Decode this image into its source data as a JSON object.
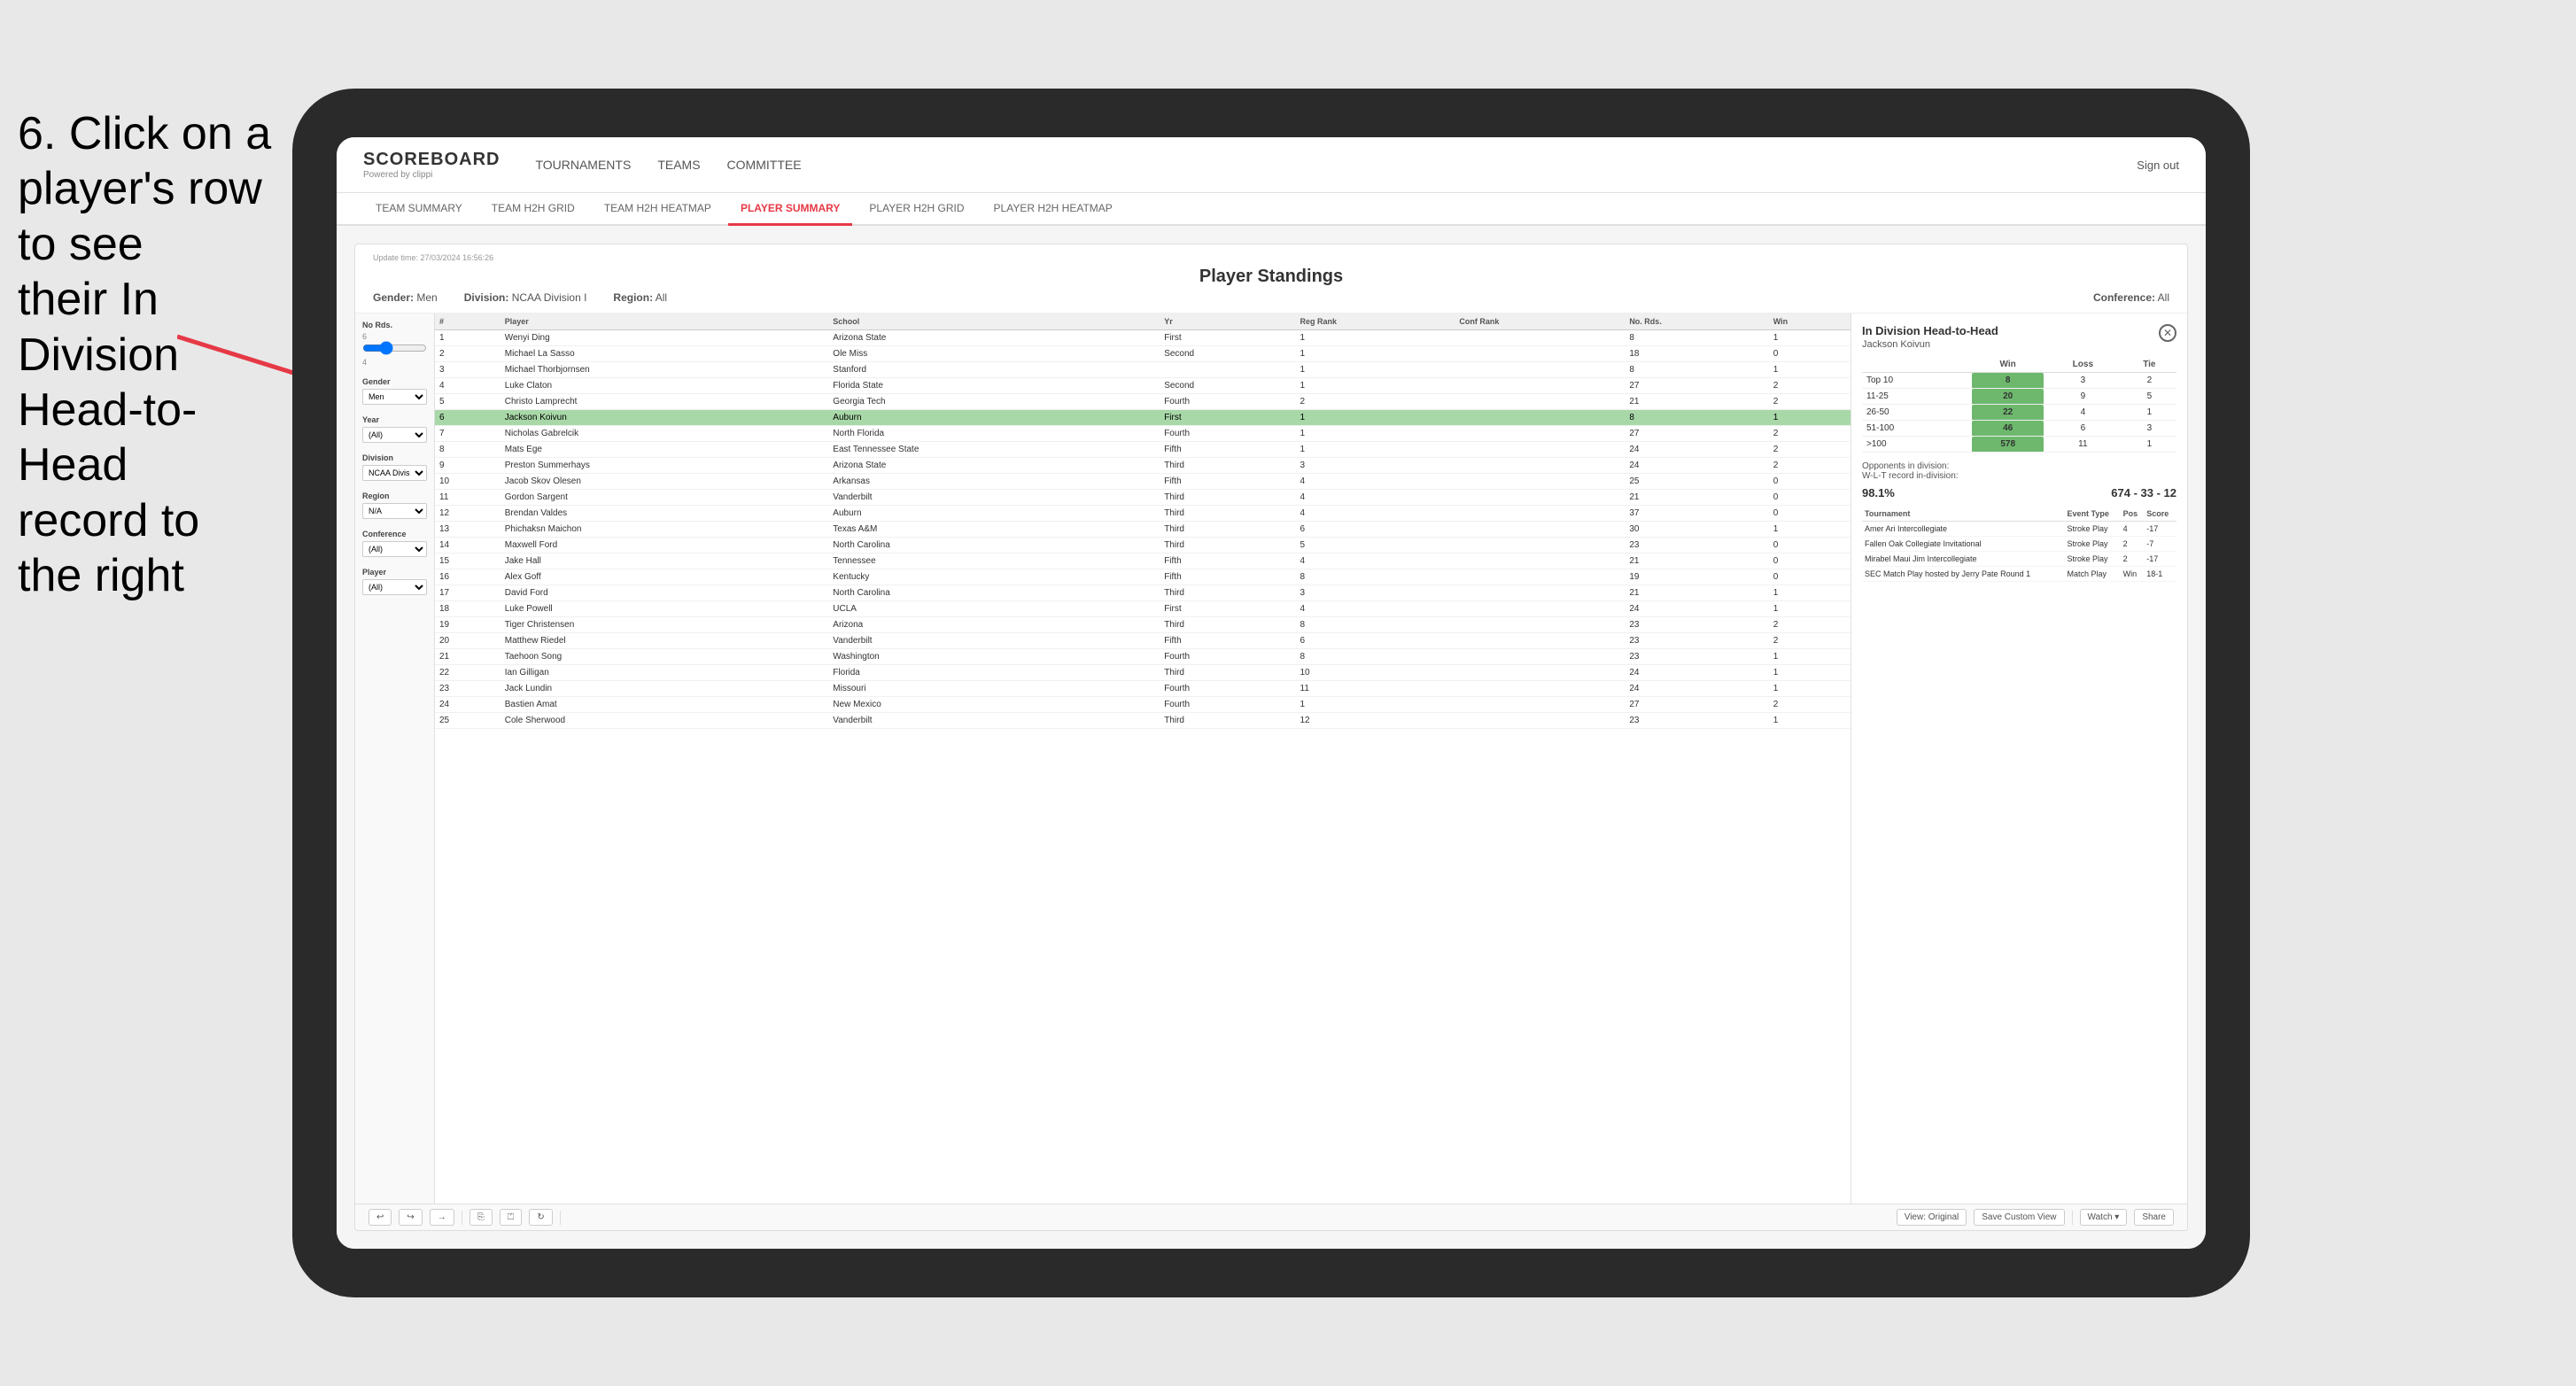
{
  "instruction": {
    "line1": "6. Click on a",
    "line2": "player's row to see",
    "line3": "their In Division",
    "line4": "Head-to-Head",
    "line5": "record to the right"
  },
  "nav": {
    "logo": "SCOREBOARD",
    "powered": "Powered by clippi",
    "items": [
      "TOURNAMENTS",
      "TEAMS",
      "COMMITTEE"
    ],
    "sign_out": "Sign out"
  },
  "sub_nav": {
    "items": [
      "TEAM SUMMARY",
      "TEAM H2H GRID",
      "TEAM H2H HEATMAP",
      "PLAYER SUMMARY",
      "PLAYER H2H GRID",
      "PLAYER H2H HEATMAP"
    ],
    "active": "PLAYER SUMMARY"
  },
  "report": {
    "update_time": "Update time:",
    "update_value": "27/03/2024 16:56:26",
    "title": "Player Standings",
    "gender_label": "Gender:",
    "gender_value": "Men",
    "division_label": "Division:",
    "division_value": "NCAA Division I",
    "region_label": "Region:",
    "region_value": "All",
    "conference_label": "Conference:",
    "conference_value": "All"
  },
  "filters": {
    "no_rds_label": "No Rds.",
    "no_rds_value": "6",
    "no_rds_min": "4",
    "gender_label": "Gender",
    "gender_value": "Men",
    "year_label": "Year",
    "year_value": "(All)",
    "division_label": "Division",
    "division_value": "NCAA Division I",
    "region_label": "Region",
    "region_value": "N/A",
    "conference_label": "Conference",
    "conference_value": "(All)",
    "player_label": "Player",
    "player_value": "(All)"
  },
  "table": {
    "headers": [
      "#",
      "Player",
      "School",
      "Yr",
      "Reg Rank",
      "Conf Rank",
      "No. Rds.",
      "Win"
    ],
    "rows": [
      {
        "num": 1,
        "player": "Wenyi Ding",
        "school": "Arizona State",
        "yr": "First",
        "reg": 1,
        "conf": "",
        "rds": 8,
        "win": 1,
        "highlighted": false
      },
      {
        "num": 2,
        "player": "Michael La Sasso",
        "school": "Ole Miss",
        "yr": "Second",
        "reg": 1,
        "conf": "",
        "rds": 18,
        "win": 0,
        "highlighted": false
      },
      {
        "num": 3,
        "player": "Michael Thorbjornsen",
        "school": "Stanford",
        "yr": "",
        "reg": 1,
        "conf": "",
        "rds": 8,
        "win": 1,
        "highlighted": false
      },
      {
        "num": 4,
        "player": "Luke Claton",
        "school": "Florida State",
        "yr": "Second",
        "reg": 1,
        "conf": "",
        "rds": 27,
        "win": 2,
        "highlighted": false
      },
      {
        "num": 5,
        "player": "Christo Lamprecht",
        "school": "Georgia Tech",
        "yr": "Fourth",
        "reg": 2,
        "conf": "",
        "rds": 21,
        "win": 2,
        "highlighted": false
      },
      {
        "num": 6,
        "player": "Jackson Koivun",
        "school": "Auburn",
        "yr": "First",
        "reg": 1,
        "conf": "",
        "rds": 8,
        "win": 1,
        "highlighted": true
      },
      {
        "num": 7,
        "player": "Nicholas Gabrelcik",
        "school": "North Florida",
        "yr": "Fourth",
        "reg": 1,
        "conf": "",
        "rds": 27,
        "win": 2,
        "highlighted": false
      },
      {
        "num": 8,
        "player": "Mats Ege",
        "school": "East Tennessee State",
        "yr": "Fifth",
        "reg": 1,
        "conf": "",
        "rds": 24,
        "win": 2,
        "highlighted": false
      },
      {
        "num": 9,
        "player": "Preston Summerhays",
        "school": "Arizona State",
        "yr": "Third",
        "reg": 3,
        "conf": "",
        "rds": 24,
        "win": 2,
        "highlighted": false
      },
      {
        "num": 10,
        "player": "Jacob Skov Olesen",
        "school": "Arkansas",
        "yr": "Fifth",
        "reg": 4,
        "conf": "",
        "rds": 25,
        "win": 0,
        "highlighted": false
      },
      {
        "num": 11,
        "player": "Gordon Sargent",
        "school": "Vanderbilt",
        "yr": "Third",
        "reg": 4,
        "conf": "",
        "rds": 21,
        "win": 0,
        "highlighted": false
      },
      {
        "num": 12,
        "player": "Brendan Valdes",
        "school": "Auburn",
        "yr": "Third",
        "reg": 4,
        "conf": "",
        "rds": 37,
        "win": 0,
        "highlighted": false
      },
      {
        "num": 13,
        "player": "Phichaksn Maichon",
        "school": "Texas A&M",
        "yr": "Third",
        "reg": 6,
        "conf": "",
        "rds": 30,
        "win": 1,
        "highlighted": false
      },
      {
        "num": 14,
        "player": "Maxwell Ford",
        "school": "North Carolina",
        "yr": "Third",
        "reg": 5,
        "conf": "",
        "rds": 23,
        "win": 0,
        "highlighted": false
      },
      {
        "num": 15,
        "player": "Jake Hall",
        "school": "Tennessee",
        "yr": "Fifth",
        "reg": 4,
        "conf": "",
        "rds": 21,
        "win": 0,
        "highlighted": false
      },
      {
        "num": 16,
        "player": "Alex Goff",
        "school": "Kentucky",
        "yr": "Fifth",
        "reg": 8,
        "conf": "",
        "rds": 19,
        "win": 0,
        "highlighted": false
      },
      {
        "num": 17,
        "player": "David Ford",
        "school": "North Carolina",
        "yr": "Third",
        "reg": 3,
        "conf": "",
        "rds": 21,
        "win": 1,
        "highlighted": false
      },
      {
        "num": 18,
        "player": "Luke Powell",
        "school": "UCLA",
        "yr": "First",
        "reg": 4,
        "conf": "",
        "rds": 24,
        "win": 1,
        "highlighted": false
      },
      {
        "num": 19,
        "player": "Tiger Christensen",
        "school": "Arizona",
        "yr": "Third",
        "reg": 8,
        "conf": "",
        "rds": 23,
        "win": 2,
        "highlighted": false
      },
      {
        "num": 20,
        "player": "Matthew Riedel",
        "school": "Vanderbilt",
        "yr": "Fifth",
        "reg": 6,
        "conf": "",
        "rds": 23,
        "win": 2,
        "highlighted": false
      },
      {
        "num": 21,
        "player": "Taehoon Song",
        "school": "Washington",
        "yr": "Fourth",
        "reg": 8,
        "conf": "",
        "rds": 23,
        "win": 1,
        "highlighted": false
      },
      {
        "num": 22,
        "player": "Ian Gilligan",
        "school": "Florida",
        "yr": "Third",
        "reg": 10,
        "conf": "",
        "rds": 24,
        "win": 1,
        "highlighted": false
      },
      {
        "num": 23,
        "player": "Jack Lundin",
        "school": "Missouri",
        "yr": "Fourth",
        "reg": 11,
        "conf": "",
        "rds": 24,
        "win": 1,
        "highlighted": false
      },
      {
        "num": 24,
        "player": "Bastien Amat",
        "school": "New Mexico",
        "yr": "Fourth",
        "reg": 1,
        "conf": "",
        "rds": 27,
        "win": 2,
        "highlighted": false
      },
      {
        "num": 25,
        "player": "Cole Sherwood",
        "school": "Vanderbilt",
        "yr": "Third",
        "reg": 12,
        "conf": "",
        "rds": 23,
        "win": 1,
        "highlighted": false
      }
    ]
  },
  "h2h": {
    "title": "In Division Head-to-Head",
    "player": "Jackson Koivun",
    "close_btn": "✕",
    "table_headers": [
      "",
      "Win",
      "Loss",
      "Tie"
    ],
    "rows": [
      {
        "label": "Top 10",
        "win": 8,
        "loss": 3,
        "tie": 2
      },
      {
        "label": "11-25",
        "win": 20,
        "loss": 9,
        "tie": 5
      },
      {
        "label": "26-50",
        "win": 22,
        "loss": 4,
        "tie": 1
      },
      {
        "label": "51-100",
        "win": 46,
        "loss": 6,
        "tie": 3
      },
      {
        "label": ">100",
        "win": 578,
        "loss": 11,
        "tie": 1
      }
    ],
    "opponents_label": "Opponents in division:",
    "opponents_value": "98.1%",
    "wlt_label": "W-L-T record in-division:",
    "wlt_value": "674 - 33 - 12",
    "tournament_headers": [
      "Tournament",
      "Event Type",
      "Pos",
      "Score"
    ],
    "tournaments": [
      {
        "name": "Amer Ari Intercollegiate",
        "type": "Stroke Play",
        "pos": 4,
        "score": "-17"
      },
      {
        "name": "Fallen Oak Collegiate Invitational",
        "type": "Stroke Play",
        "pos": 2,
        "score": "-7"
      },
      {
        "name": "Mirabel Maui Jim Intercollegiate",
        "type": "Stroke Play",
        "pos": 2,
        "score": "-17"
      },
      {
        "name": "SEC Match Play hosted by Jerry Pate Round 1",
        "type": "Match Play",
        "pos": "Win",
        "score": "18-1"
      }
    ]
  },
  "toolbar": {
    "undo": "↩",
    "redo": "↪",
    "forward": "→",
    "copy": "⎘",
    "paste": "⏍",
    "refresh": "↻",
    "view_original": "View: Original",
    "save_custom": "Save Custom View",
    "watch": "Watch ▾",
    "share": "Share"
  }
}
